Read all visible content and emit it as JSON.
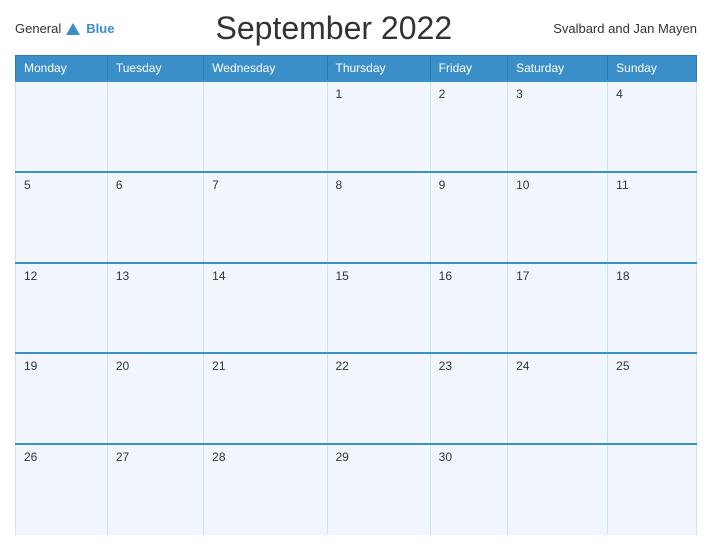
{
  "header": {
    "logo": {
      "general": "General",
      "blue": "Blue",
      "triangle": true
    },
    "title": "September 2022",
    "region": "Svalbard and Jan Mayen"
  },
  "weekdays": [
    "Monday",
    "Tuesday",
    "Wednesday",
    "Thursday",
    "Friday",
    "Saturday",
    "Sunday"
  ],
  "weeks": [
    [
      "",
      "",
      "",
      "1",
      "2",
      "3",
      "4"
    ],
    [
      "5",
      "6",
      "7",
      "8",
      "9",
      "10",
      "11"
    ],
    [
      "12",
      "13",
      "14",
      "15",
      "16",
      "17",
      "18"
    ],
    [
      "19",
      "20",
      "21",
      "22",
      "23",
      "24",
      "25"
    ],
    [
      "26",
      "27",
      "28",
      "29",
      "30",
      "",
      ""
    ]
  ]
}
